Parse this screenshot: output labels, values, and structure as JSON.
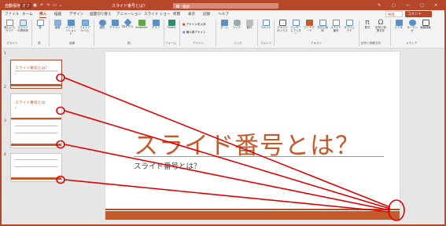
{
  "titlebar": {
    "autosave": "自動保存",
    "autosave_state": "オフ",
    "doc_title": "スライド番号とは？",
    "search_placeholder": "検索"
  },
  "tabs": [
    "ファイル",
    "ホーム",
    "挿入",
    "描画",
    "デザイン",
    "画面切り替え",
    "アニメーション",
    "スライド ショー",
    "校閲",
    "表示",
    "記録",
    "ヘルプ"
  ],
  "active_tab": "挿入",
  "share_label": "共有",
  "comment_label": "コメント",
  "ribbon": {
    "buttons": {
      "new_slide": "新しいスライド",
      "reuse": "スライドの再利用",
      "table": "表",
      "image": "画像",
      "screenshot": "スクリーンショット",
      "album": "フォトアルバム",
      "shapes": "図形",
      "icons": "アイコン",
      "model3d": "3Dモデル",
      "smartart": "SmartArt",
      "graph": "グラフ",
      "forms": "Forms",
      "addin_get": "アドインを入手",
      "addin_mine": "個人用アドイン",
      "zoom": "ズーム",
      "link": "リンク",
      "action": "動作",
      "comment": "コメント",
      "textbox": "テキストボックス",
      "header": "ヘッダーとフッター",
      "wordart": "ワードアート",
      "datetime": "日付と時刻",
      "slidenum": "スライド番号",
      "object": "オブジェクト",
      "equation": "数式",
      "symbol": "記号と特殊文字",
      "video": "ビデオ",
      "audio": "オーディオ",
      "record": "画面録画"
    },
    "groups": {
      "slides": "スライド",
      "tables": "表",
      "images": "画像",
      "illustrations": "図",
      "forms": "フォーム",
      "addins": "アドイン",
      "links": "リンク",
      "comments": "コメント",
      "text": "テキスト",
      "symbols": "記号と特殊文字",
      "media": "メディア"
    }
  },
  "thumbnails": [
    {
      "number": "1",
      "title": "スライド番号とは？",
      "subtitle": "1"
    },
    {
      "number": "2",
      "title": "スライド番号とは",
      "subtitle": "2"
    },
    {
      "number": "3",
      "title": "",
      "subtitle": ""
    },
    {
      "number": "4",
      "title": "",
      "subtitle": ""
    }
  ],
  "slide": {
    "title": "スライド番号とは？",
    "subtitle": "スライド番号とは？"
  },
  "colors": {
    "accent": "#b7472a",
    "slide_orange": "#c55a2b",
    "annotation": "#e00000"
  }
}
